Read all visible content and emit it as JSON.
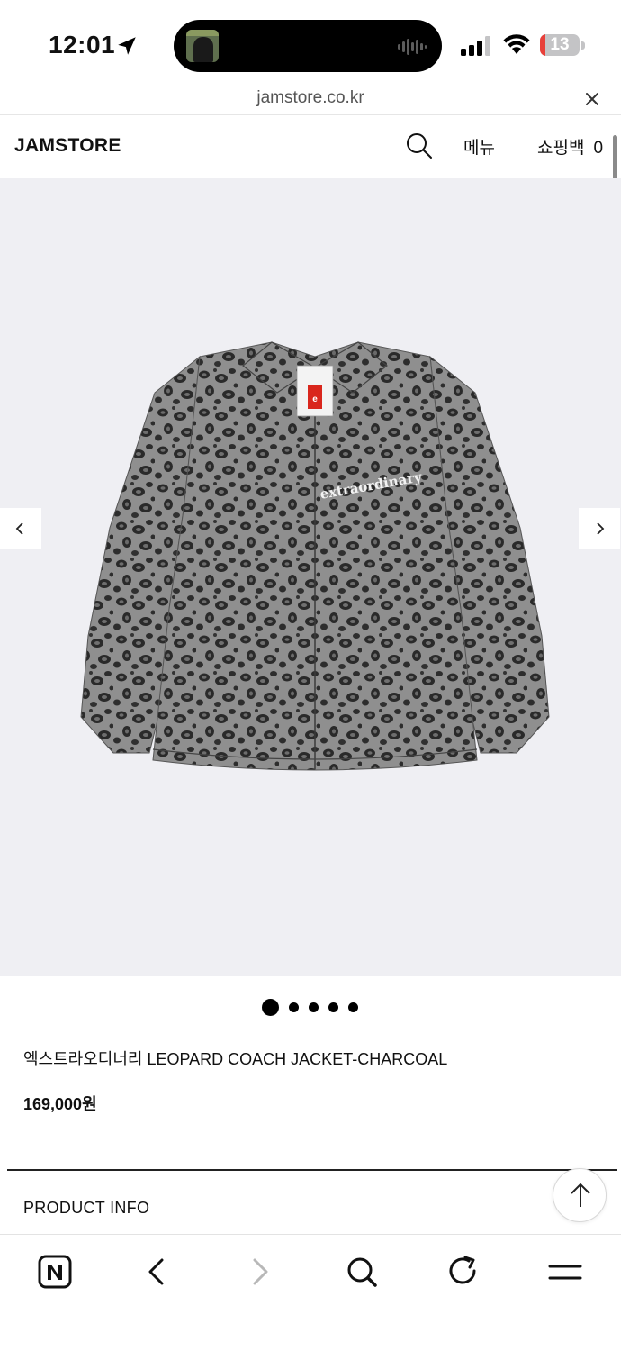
{
  "status_bar": {
    "time": "12:01",
    "battery_level": "13",
    "battery_fraction": 0.13,
    "battery_color": "#e8403a",
    "icons": [
      "location-arrow-icon",
      "audio-wave-icon",
      "cellular-signal-icon",
      "wifi-icon",
      "battery-icon"
    ]
  },
  "browser": {
    "url": "jamstore.co.kr",
    "toolbar_icons": [
      "naver-home-icon",
      "back-icon",
      "forward-icon",
      "search-icon",
      "reload-icon",
      "menu-icon"
    ]
  },
  "header": {
    "logo": "JAMSTORE",
    "menu_label": "메뉴",
    "cart_label": "쇼핑백",
    "cart_count": "0"
  },
  "gallery": {
    "background": "#efeff3",
    "slide_count": 5,
    "active_slide": 1,
    "jacket_print": "extraordinary"
  },
  "product": {
    "name": "엑스트라오디너리 LEOPARD COACH JACKET-CHARCOAL",
    "price": "169,000원"
  },
  "sections": {
    "info_heading": "PRODUCT INFO"
  }
}
